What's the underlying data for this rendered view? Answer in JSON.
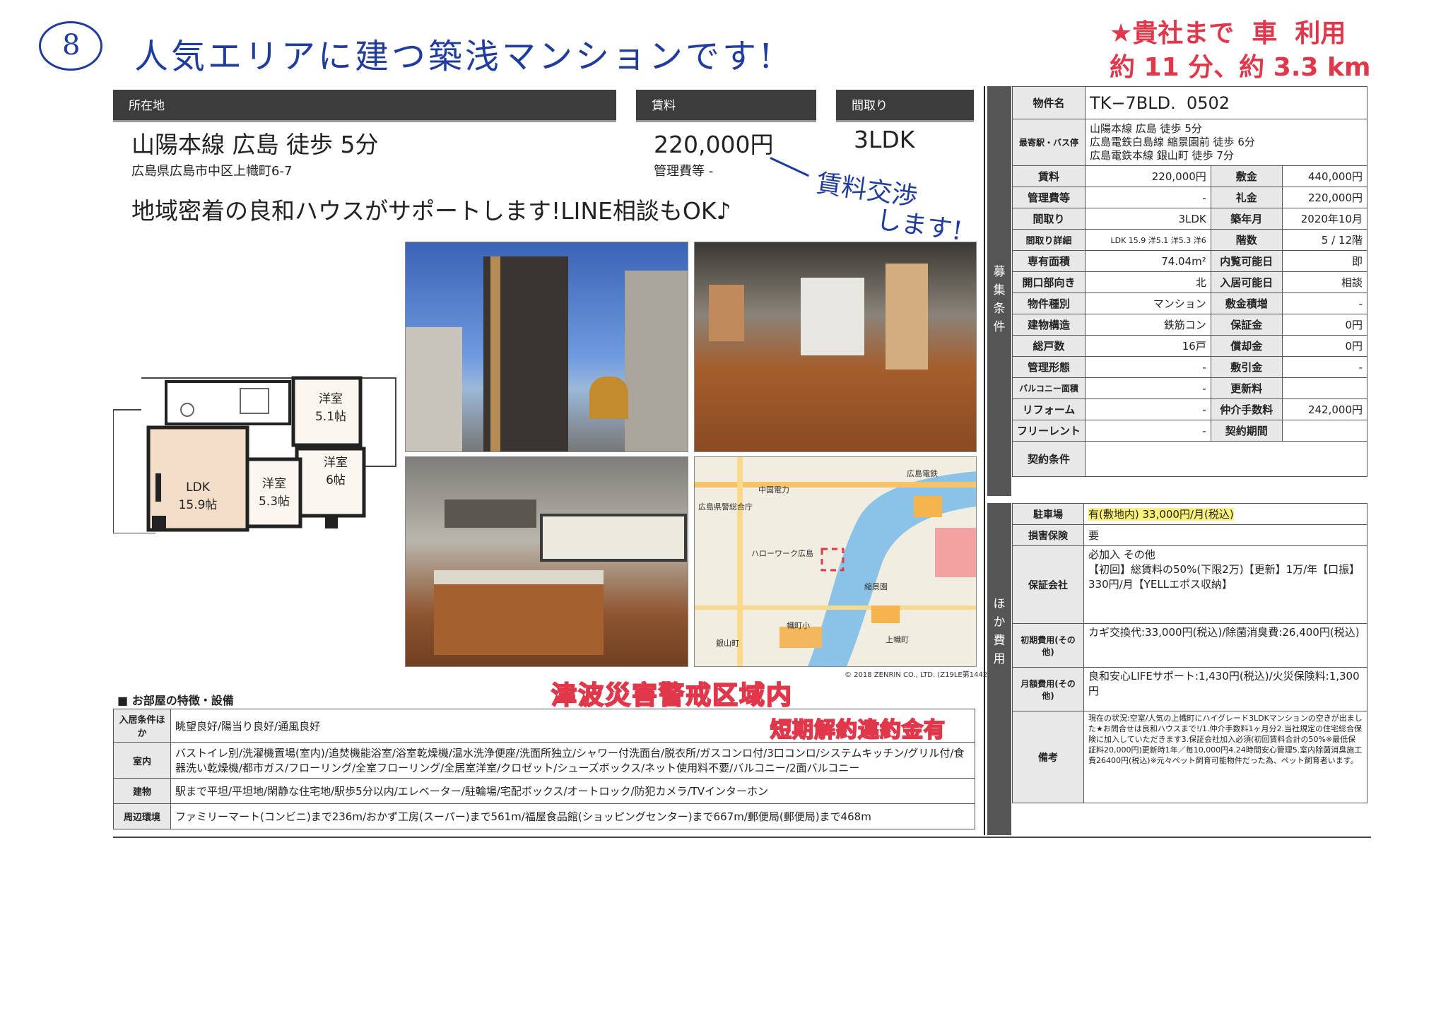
{
  "handwritten": {
    "circle_number": "8",
    "top_note": "人気エリアに建つ築浅マンションです!",
    "rent_note_line1": "賃料交渉",
    "rent_note_line2": "します!",
    "red_note_line1": "★貴社まで  車  利用",
    "red_note_line2": "約 11 分、約 3.3 km",
    "stamp_tsunami": "津波災害警戒区域内",
    "stamp_penalty": "短期解約違約金有"
  },
  "headers": {
    "location_label": "所在地",
    "rent_label": "賃料",
    "layout_label": "間取り"
  },
  "summary": {
    "access": "山陽本線 広島 徒歩 5分",
    "address": "広島県広島市中区上幟町6-7",
    "rent": "220,000円",
    "mgmt_fee": "管理費等 -",
    "layout": "3LDK",
    "slogan": "地域密着の良和ハウスがサポートします!LINE相談もOK♪"
  },
  "floorplan": {
    "ldk": "LDK",
    "ldk_size": "15.9帖",
    "room1": "洋室",
    "room1_size": "5.1帖",
    "room2": "洋室",
    "room2_size": "6帖",
    "room3": "洋室",
    "room3_size": "5.3帖"
  },
  "map": {
    "copyright": "© 2018 ZENRIN CO., LTD. (Z19LE第1442号)",
    "labels": [
      "広島県警総合庁",
      "中国電力",
      "ハローワーク広島",
      "縮景園",
      "幟町小",
      "上幟町",
      "広島電鉄",
      "銀山町"
    ]
  },
  "features": {
    "title": "■ お部屋の特徴・設備",
    "rows": [
      {
        "label": "入居条件ほか",
        "value": "眺望良好/陽当り良好/通風良好"
      },
      {
        "label": "室内",
        "value": "バストイレ別/洗濯機置場(室内)/追焚機能浴室/浴室乾燥機/温水洗浄便座/洗面所独立/シャワー付洗面台/脱衣所/ガスコンロ付/3口コンロ/システムキッチン/グリル付/食器洗い乾燥機/都市ガス/フローリング/全室フローリング/全居室洋室/クロゼット/シューズボックス/ネット使用料不要/バルコニー/2面バルコニー"
      },
      {
        "label": "建物",
        "value": "駅まで平坦/平坦地/閑静な住宅地/駅歩5分以内/エレベーター/駐輪場/宅配ボックス/オートロック/防犯カメラ/TVインターホン"
      },
      {
        "label": "周辺環境",
        "value": "ファミリーマート(コンビニ)まで236m/おかず工房(スーパー)まで561m/福屋食品館(ショッピングセンター)まで667m/郵便局(郵便局)まで468m"
      }
    ]
  },
  "boshu": {
    "side_label": "募集条件",
    "property_name_label": "物件名",
    "property_name": "TK−7BLD.  0502",
    "station_label": "最寄駅・バス停",
    "station_lines": [
      "山陽本線 広島 徒歩 5分",
      "広島電鉄白島線 縮景園前 徒歩 6分",
      "広島電鉄本線 銀山町 徒歩 7分"
    ],
    "rows": [
      {
        "l1": "賃料",
        "v1": "220,000円",
        "l2": "敷金",
        "v2": "440,000円"
      },
      {
        "l1": "管理費等",
        "v1": "-",
        "l2": "礼金",
        "v2": "220,000円"
      },
      {
        "l1": "間取り",
        "v1": "3LDK",
        "l2": "築年月",
        "v2": "2020年10月"
      },
      {
        "l1": "間取り詳細",
        "v1": "LDK 15.9 洋5.1 洋5.3 洋6",
        "l2": "階数",
        "v2": "5 / 12階"
      },
      {
        "l1": "専有面積",
        "v1": "74.04m²",
        "l2": "内覧可能日",
        "v2": "即"
      },
      {
        "l1": "開口部向き",
        "v1": "北",
        "l2": "入居可能日",
        "v2": "相談"
      },
      {
        "l1": "物件種別",
        "v1": "マンション",
        "l2": "敷金積増",
        "v2": "-"
      },
      {
        "l1": "建物構造",
        "v1": "鉄筋コン",
        "l2": "保証金",
        "v2": "0円"
      },
      {
        "l1": "総戸数",
        "v1": "16戸",
        "l2": "償却金",
        "v2": "0円"
      },
      {
        "l1": "管理形態",
        "v1": "-",
        "l2": "敷引金",
        "v2": "-"
      },
      {
        "l1": "バルコニー面積",
        "v1": "-",
        "l2": "更新料",
        "v2": ""
      },
      {
        "l1": "リフォーム",
        "v1": "-",
        "l2": "仲介手数料",
        "v2": "242,000円"
      },
      {
        "l1": "フリーレント",
        "v1": "-",
        "l2": "契約期間",
        "v2": ""
      }
    ],
    "contract_label": "契約条件",
    "contract_value": ""
  },
  "hoka": {
    "side_label": "ほか費用",
    "parking_label": "駐車場",
    "parking": "有(敷地内) 33,000円/月(税込)",
    "insurance_label": "損害保険",
    "insurance": "要",
    "guarantee_label": "保証会社",
    "guarantee": "必加入 その他\n【初回】総賃料の50%(下限2万)【更新】1万/年【口振】330円/月【YELLエポス収納】",
    "initial_label": "初期費用(その他)",
    "initial": "カギ交換代:33,000円(税込)/除菌消臭費:26,400円(税込)",
    "monthly_label": "月額費用(その他)",
    "monthly": "良和安心LIFEサポート:1,430円(税込)/火災保険料:1,300円",
    "remarks_label": "備考",
    "remarks": "現在の状況:空室/人気の上幟町にハイグレード3LDKマンションの空きが出ました★お問合せは良和ハウスまで!/1.仲介手数料1ヶ月分2.当社規定の住宅総合保険に加入していただきます3.保証会社加入必須(初回賃料合計の50%※最低保証料20,000円)更新時1年／毎10,000円4.24時間安心管理5.室内除菌消臭施工費26400円(税込)※元々ペット飼育可能物件だった為、ペット飼育者います。"
  },
  "colors": {
    "header_bar": "#3c3c3c",
    "handwriting_blue": "#1f3c9e",
    "handwriting_red": "#e0384a",
    "highlight_yellow": "#fff27a"
  }
}
